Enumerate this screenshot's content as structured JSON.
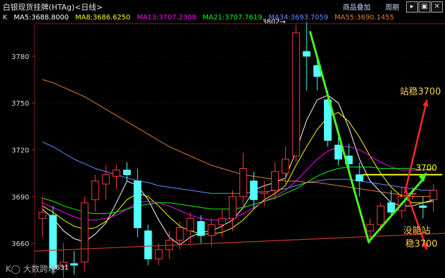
{
  "window": {
    "title": "白银现货挂牌(HTAg)<日线>",
    "buttons": [
      "商品叠加",
      "周期"
    ],
    "controls": [
      "▸",
      "▣",
      "✕"
    ]
  },
  "indicator_label": "K",
  "moving_averages": [
    {
      "label": "MA5:3688.8000",
      "color": "#ffffff"
    },
    {
      "label": "MA8:3686.6250",
      "color": "#ffff00"
    },
    {
      "label": "MA13:3707.2308",
      "color": "#ff00ff"
    },
    {
      "label": "MA21:3707.7619",
      "color": "#00ff00"
    },
    {
      "label": "MA34:3693.7059",
      "color": "#6a8cff"
    },
    {
      "label": "MA55:3690.1455",
      "color": "#e0802a"
    }
  ],
  "watermark": "大数跨境",
  "chart_data": {
    "type": "candlestick",
    "ylim": [
      3640,
      3800
    ],
    "y_ticks": [
      3660,
      3690,
      3720,
      3750,
      3780
    ],
    "candles": [
      {
        "o": 3676,
        "h": 3690,
        "l": 3664,
        "c": 3680
      },
      {
        "o": 3678,
        "h": 3684,
        "l": 3640,
        "c": 3644
      },
      {
        "o": 3645,
        "h": 3660,
        "l": 3638,
        "c": 3648
      },
      {
        "o": 3647,
        "h": 3655,
        "l": 3640,
        "c": 3646
      },
      {
        "o": 3648,
        "h": 3690,
        "l": 3642,
        "c": 3686
      },
      {
        "o": 3688,
        "h": 3704,
        "l": 3680,
        "c": 3700
      },
      {
        "o": 3698,
        "h": 3710,
        "l": 3688,
        "c": 3704
      },
      {
        "o": 3703,
        "h": 3710,
        "l": 3695,
        "c": 3707
      },
      {
        "o": 3707,
        "h": 3712,
        "l": 3700,
        "c": 3704
      },
      {
        "o": 3700,
        "h": 3708,
        "l": 3664,
        "c": 3670
      },
      {
        "o": 3668,
        "h": 3672,
        "l": 3646,
        "c": 3650
      },
      {
        "o": 3650,
        "h": 3660,
        "l": 3646,
        "c": 3656
      },
      {
        "o": 3656,
        "h": 3668,
        "l": 3650,
        "c": 3662
      },
      {
        "o": 3662,
        "h": 3674,
        "l": 3656,
        "c": 3670
      },
      {
        "o": 3668,
        "h": 3680,
        "l": 3660,
        "c": 3676
      },
      {
        "o": 3674,
        "h": 3678,
        "l": 3660,
        "c": 3665
      },
      {
        "o": 3665,
        "h": 3676,
        "l": 3658,
        "c": 3672
      },
      {
        "o": 3672,
        "h": 3682,
        "l": 3664,
        "c": 3676
      },
      {
        "o": 3676,
        "h": 3694,
        "l": 3668,
        "c": 3690
      },
      {
        "o": 3690,
        "h": 3718,
        "l": 3684,
        "c": 3708
      },
      {
        "o": 3700,
        "h": 3706,
        "l": 3682,
        "c": 3688
      },
      {
        "o": 3692,
        "h": 3700,
        "l": 3684,
        "c": 3693
      },
      {
        "o": 3694,
        "h": 3712,
        "l": 3688,
        "c": 3706
      },
      {
        "o": 3705,
        "h": 3722,
        "l": 3698,
        "c": 3714
      },
      {
        "o": 3716,
        "h": 3800,
        "l": 3712,
        "c": 3795
      },
      {
        "o": 3783,
        "h": 3802,
        "l": 3758,
        "c": 3780
      },
      {
        "o": 3774,
        "h": 3780,
        "l": 3758,
        "c": 3767
      },
      {
        "o": 3752,
        "h": 3758,
        "l": 3722,
        "c": 3726
      },
      {
        "o": 3723,
        "h": 3728,
        "l": 3710,
        "c": 3714
      },
      {
        "o": 3716,
        "h": 3724,
        "l": 3708,
        "c": 3711
      },
      {
        "o": 3704,
        "h": 3712,
        "l": 3690,
        "c": 3700
      },
      {
        "o": 3668,
        "h": 3676,
        "l": 3660,
        "c": 3672
      },
      {
        "o": 3672,
        "h": 3686,
        "l": 3668,
        "c": 3684
      },
      {
        "o": 3686,
        "h": 3694,
        "l": 3678,
        "c": 3680
      },
      {
        "o": 3681,
        "h": 3696,
        "l": 3676,
        "c": 3690
      },
      {
        "o": 3692,
        "h": 3696,
        "l": 3688,
        "c": 3692
      },
      {
        "o": 3684,
        "h": 3690,
        "l": 3676,
        "c": 3683
      },
      {
        "o": 3688,
        "h": 3698,
        "l": 3680,
        "c": 3694
      }
    ],
    "ma_lines": [
      {
        "name": "MA5",
        "color": "#ffffff",
        "values": [
          3682,
          3676,
          3668,
          3663,
          3661,
          3666,
          3673,
          3686,
          3700,
          3697,
          3688,
          3675,
          3664,
          3659,
          3664,
          3667,
          3668,
          3671,
          3675,
          3683,
          3694,
          3697,
          3699,
          3702,
          3719,
          3739,
          3752,
          3755,
          3750,
          3734,
          3714,
          3700,
          3693,
          3686,
          3684,
          3684,
          3686,
          3688
        ]
      },
      {
        "name": "MA8",
        "color": "#ffff00",
        "values": [
          3684,
          3680,
          3675,
          3671,
          3669,
          3670,
          3674,
          3680,
          3688,
          3692,
          3690,
          3684,
          3677,
          3671,
          3668,
          3666,
          3666,
          3667,
          3670,
          3675,
          3682,
          3688,
          3692,
          3697,
          3710,
          3722,
          3733,
          3741,
          3744,
          3738,
          3728,
          3716,
          3705,
          3696,
          3690,
          3686,
          3686,
          3687
        ]
      },
      {
        "name": "MA13",
        "color": "#ff00ff",
        "values": [
          3686,
          3683,
          3680,
          3677,
          3675,
          3675,
          3676,
          3678,
          3682,
          3686,
          3687,
          3686,
          3684,
          3681,
          3678,
          3676,
          3675,
          3675,
          3676,
          3679,
          3683,
          3687,
          3690,
          3694,
          3700,
          3707,
          3714,
          3719,
          3722,
          3722,
          3720,
          3716,
          3712,
          3709,
          3707,
          3707,
          3707,
          3707
        ]
      },
      {
        "name": "MA21",
        "color": "#00ff00",
        "values": [
          3689,
          3687,
          3684,
          3682,
          3680,
          3679,
          3679,
          3680,
          3682,
          3684,
          3685,
          3686,
          3686,
          3685,
          3684,
          3683,
          3682,
          3682,
          3682,
          3683,
          3685,
          3687,
          3689,
          3692,
          3695,
          3699,
          3703,
          3706,
          3708,
          3709,
          3709,
          3709,
          3708,
          3708,
          3708,
          3708,
          3707,
          3708
        ]
      },
      {
        "name": "MA34",
        "color": "#6a8cff",
        "values": [
          3725,
          3722,
          3718,
          3714,
          3711,
          3708,
          3706,
          3704,
          3702,
          3700,
          3699,
          3697,
          3696,
          3695,
          3694,
          3693,
          3692,
          3692,
          3692,
          3692,
          3693,
          3693,
          3694,
          3695,
          3697,
          3699,
          3700,
          3701,
          3701,
          3701,
          3700,
          3699,
          3698,
          3697,
          3696,
          3695,
          3694,
          3694
        ]
      },
      {
        "name": "MA55",
        "color": "#e0802a",
        "values": [
          3765,
          3763,
          3760,
          3757,
          3754,
          3750,
          3746,
          3742,
          3738,
          3734,
          3730,
          3726,
          3722,
          3719,
          3716,
          3713,
          3710,
          3708,
          3706,
          3704,
          3703,
          3702,
          3701,
          3700,
          3700,
          3699,
          3699,
          3698,
          3697,
          3696,
          3695,
          3694,
          3693,
          3692,
          3691,
          3690,
          3690,
          3690
        ]
      }
    ],
    "support_line": {
      "from": {
        "x": 0,
        "y": 3655
      },
      "to": {
        "x": 37,
        "y": 3667
      },
      "color": "#c0392b"
    },
    "resistance_line": {
      "y": 3704,
      "from_x": 30,
      "to_x": 37,
      "label": "3700",
      "color": "#ffff00"
    },
    "high_label": {
      "index": 24,
      "value": 3802,
      "text": "3802"
    },
    "low_label": {
      "index": 2,
      "value": 3631,
      "text": "3631"
    },
    "annotations": {
      "up_text": "站稳3700",
      "down_text_1": "没能站",
      "down_text_2": "稳3700",
      "trend_color": "#44ff22",
      "arrow_color": "#ff2a2a"
    }
  }
}
